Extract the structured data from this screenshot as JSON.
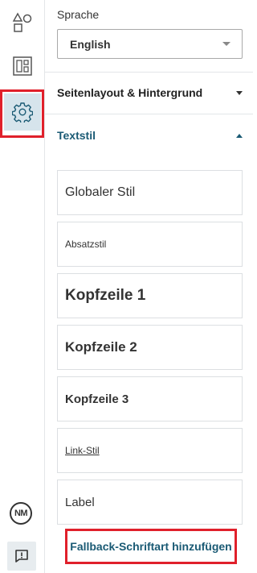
{
  "rail": {
    "icons": [
      "shapes-icon",
      "layout-icon",
      "gear-icon"
    ],
    "avatar_initials": "NM",
    "feedback_icon": "feedback-icon"
  },
  "language": {
    "label": "Sprache",
    "selected": "English"
  },
  "sections": {
    "page_layout": "Seitenlayout & Hintergrund",
    "text_style": "Textstil"
  },
  "text_styles": [
    "Globaler Stil",
    "Absatzstil",
    "Kopfzeile 1",
    "Kopfzeile 2",
    "Kopfzeile 3",
    "Link-Stil",
    "Label"
  ],
  "fallback_button": "Fallback-Schriftart hinzufügen",
  "colors": {
    "accent": "#1a5a74",
    "highlight": "#e0202b",
    "active_rail": "#d6e4ec"
  }
}
